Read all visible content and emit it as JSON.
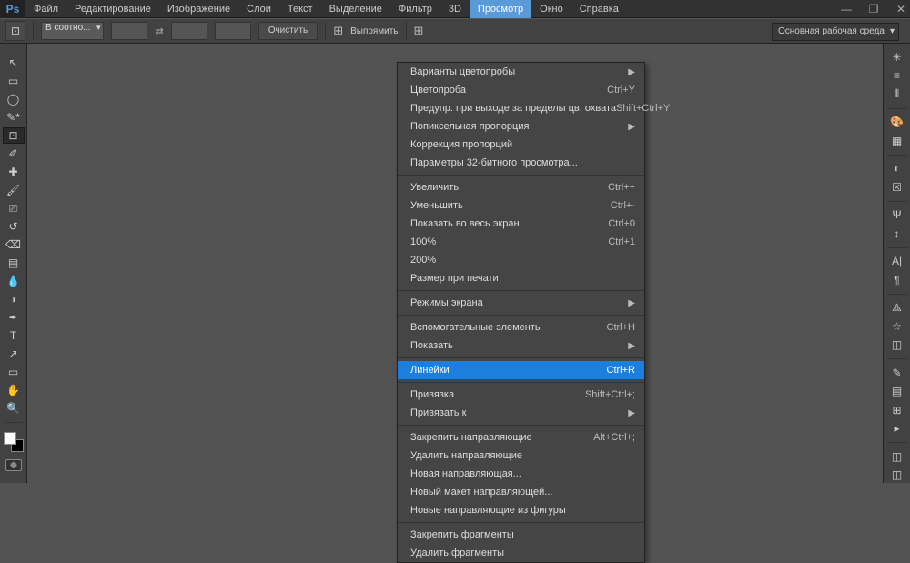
{
  "menubar": [
    "Файл",
    "Редактирование",
    "Изображение",
    "Слои",
    "Текст",
    "Выделение",
    "Фильтр",
    "3D",
    "Просмотр",
    "Окно",
    "Справка"
  ],
  "menubar_open_index": 8,
  "optionsbar": {
    "ratio_label": "В соотно...",
    "clear_btn": "Очистить",
    "straighten": "Выпрямить"
  },
  "workspace": "Основная рабочая среда",
  "dropdown": {
    "sections": [
      [
        {
          "label": "Варианты цветопробы",
          "shortcut": "",
          "sub": true
        },
        {
          "label": "Цветопроба",
          "shortcut": "Ctrl+Y"
        },
        {
          "label": "Предупр. при выходе за пределы цв. охвата",
          "shortcut": "Shift+Ctrl+Y"
        },
        {
          "label": "Попиксельная пропорция",
          "shortcut": "",
          "sub": true
        },
        {
          "label": "Коррекция пропорций",
          "shortcut": ""
        },
        {
          "label": "Параметры 32-битного просмотра...",
          "shortcut": ""
        }
      ],
      [
        {
          "label": "Увеличить",
          "shortcut": "Ctrl++"
        },
        {
          "label": "Уменьшить",
          "shortcut": "Ctrl+-"
        },
        {
          "label": "Показать во весь экран",
          "shortcut": "Ctrl+0"
        },
        {
          "label": "100%",
          "shortcut": "Ctrl+1"
        },
        {
          "label": "200%",
          "shortcut": ""
        },
        {
          "label": "Размер при печати",
          "shortcut": ""
        }
      ],
      [
        {
          "label": "Режимы экрана",
          "shortcut": "",
          "sub": true
        }
      ],
      [
        {
          "label": "Вспомогательные элементы",
          "shortcut": "Ctrl+H"
        },
        {
          "label": "Показать",
          "shortcut": "",
          "sub": true
        }
      ],
      [
        {
          "label": "Линейки",
          "shortcut": "Ctrl+R",
          "highlight": true
        }
      ],
      [
        {
          "label": "Привязка",
          "shortcut": "Shift+Ctrl+;"
        },
        {
          "label": "Привязать к",
          "shortcut": "",
          "sub": true
        }
      ],
      [
        {
          "label": "Закрепить направляющие",
          "shortcut": "Alt+Ctrl+;"
        },
        {
          "label": "Удалить направляющие",
          "shortcut": ""
        },
        {
          "label": "Новая направляющая...",
          "shortcut": ""
        },
        {
          "label": "Новый макет направляющей...",
          "shortcut": ""
        },
        {
          "label": "Новые направляющие из фигуры",
          "shortcut": ""
        }
      ],
      [
        {
          "label": "Закрепить фрагменты",
          "shortcut": ""
        },
        {
          "label": "Удалить фрагменты",
          "shortcut": ""
        }
      ]
    ]
  },
  "left_tools": [
    {
      "name": "move-tool",
      "glyph": "↖"
    },
    {
      "name": "marquee-tool",
      "glyph": "▭"
    },
    {
      "name": "lasso-tool",
      "glyph": "◯"
    },
    {
      "name": "quick-select-tool",
      "glyph": "✎*"
    },
    {
      "name": "crop-tool",
      "glyph": "⊡",
      "active": true
    },
    {
      "name": "eyedropper-tool",
      "glyph": "✐"
    },
    {
      "name": "healing-tool",
      "glyph": "✚"
    },
    {
      "name": "brush-tool",
      "glyph": "🖌"
    },
    {
      "name": "stamp-tool",
      "glyph": "⎚"
    },
    {
      "name": "history-brush-tool",
      "glyph": "↺"
    },
    {
      "name": "eraser-tool",
      "glyph": "⌫"
    },
    {
      "name": "gradient-tool",
      "glyph": "▤"
    },
    {
      "name": "blur-tool",
      "glyph": "💧"
    },
    {
      "name": "dodge-tool",
      "glyph": "◑"
    },
    {
      "name": "pen-tool",
      "glyph": "✒"
    },
    {
      "name": "type-tool",
      "glyph": "T"
    },
    {
      "name": "path-tool",
      "glyph": "↗"
    },
    {
      "name": "shape-tool",
      "glyph": "▭"
    },
    {
      "name": "hand-tool",
      "glyph": "✋"
    },
    {
      "name": "zoom-tool",
      "glyph": "🔍"
    }
  ],
  "right_panels": [
    {
      "name": "brushes-panel",
      "glyph": "✳"
    },
    {
      "name": "history-panel",
      "glyph": "≡"
    },
    {
      "name": "histogram-panel",
      "glyph": "⫴"
    },
    {
      "sep": true
    },
    {
      "name": "color-panel",
      "glyph": "🎨"
    },
    {
      "name": "swatches-panel",
      "glyph": "▦"
    },
    {
      "sep": true
    },
    {
      "name": "adjustments-panel",
      "glyph": "◐"
    },
    {
      "name": "styles-panel",
      "glyph": "☒"
    },
    {
      "sep": true
    },
    {
      "name": "character-panel",
      "glyph": "Ψ"
    },
    {
      "name": "paragraph-panel",
      "glyph": "↕"
    },
    {
      "sep": true
    },
    {
      "name": "glyphs-panel",
      "glyph": "A|"
    },
    {
      "name": "paragraph-style-panel",
      "glyph": "¶"
    },
    {
      "sep": true
    },
    {
      "name": "3d-panel",
      "glyph": "⟁"
    },
    {
      "name": "layers-comp-panel",
      "glyph": "☆"
    },
    {
      "name": "layers-panel",
      "glyph": "◫"
    },
    {
      "sep": true
    },
    {
      "name": "notes-panel",
      "glyph": "✎"
    },
    {
      "name": "timeline-panel",
      "glyph": "▤"
    },
    {
      "name": "measure-panel",
      "glyph": "⊞"
    },
    {
      "name": "actions-panel",
      "glyph": "▸"
    },
    {
      "sep": true
    },
    {
      "name": "paths-panel",
      "glyph": "◫"
    },
    {
      "name": "channels-panel",
      "glyph": "◫"
    }
  ]
}
